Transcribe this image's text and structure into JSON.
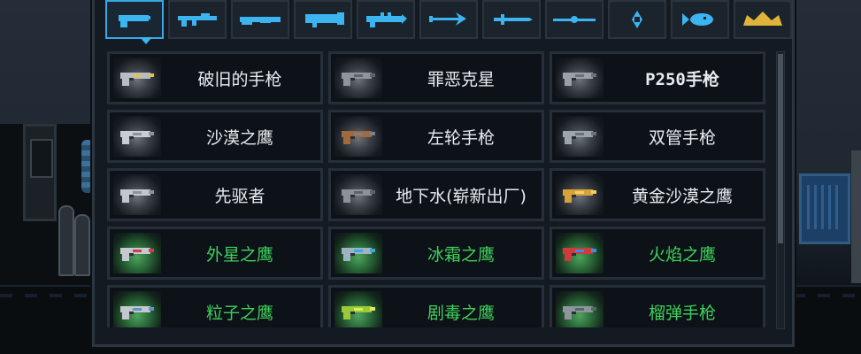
{
  "colors": {
    "tab_icon": "#3bb4f0",
    "tab_icon_gold": "#e0b33a",
    "normal_name": "#e9ecef",
    "alien_name": "#3fd15b",
    "selected_border": "#37a8e6"
  },
  "tabs": [
    {
      "icon": "pistol-icon",
      "selected": true
    },
    {
      "icon": "rifle-icon",
      "selected": false
    },
    {
      "icon": "shotgun-icon",
      "selected": false
    },
    {
      "icon": "launcher-icon",
      "selected": false
    },
    {
      "icon": "laser-gun-icon",
      "selected": false
    },
    {
      "icon": "bow-icon",
      "selected": false
    },
    {
      "icon": "sword-icon",
      "selected": false
    },
    {
      "icon": "staff-icon",
      "selected": false
    },
    {
      "icon": "shuriken-icon",
      "selected": false
    },
    {
      "icon": "fish-icon",
      "selected": false
    },
    {
      "icon": "crown-icon",
      "selected": false
    }
  ],
  "weapons": [
    {
      "name": "破旧的手枪",
      "icon": "old-pistol-icon",
      "tint": "#b9bec4",
      "accent": "#e3c14f",
      "alien": false
    },
    {
      "name": "罪恶克星",
      "icon": "revolver-icon",
      "tint": "#8e959c",
      "accent": "#5d646b",
      "alien": false
    },
    {
      "name": "P250手枪",
      "icon": "p250-pistol-icon",
      "tint": "#9aa1a8",
      "accent": "#6a7178",
      "alien": false
    },
    {
      "name": "沙漠之鹰",
      "icon": "desert-eagle-icon",
      "tint": "#c9ced3",
      "accent": "#8d949b",
      "alien": false
    },
    {
      "name": "左轮手枪",
      "icon": "wood-revolver-icon",
      "tint": "#a06a3c",
      "accent": "#7a8188",
      "alien": false
    },
    {
      "name": "双管手枪",
      "icon": "double-barrel-pistol-icon",
      "tint": "#9ea5ac",
      "accent": "#6a7178",
      "alien": false
    },
    {
      "name": "先驱者",
      "icon": "pioneer-pistol-icon",
      "tint": "#c3c8cd",
      "accent": "#8d949b",
      "alien": false
    },
    {
      "name": "地下水(崭新出厂)",
      "icon": "smg-pistol-icon",
      "tint": "#8b9299",
      "accent": "#5d646b",
      "alien": false
    },
    {
      "name": "黄金沙漠之鹰",
      "icon": "golden-eagle-icon",
      "tint": "#d8a23a",
      "accent": "#f2cf6a",
      "alien": false
    },
    {
      "name": "外星之鹰",
      "icon": "alien-eagle-icon",
      "tint": "#c8c9cf",
      "accent": "#d13a52",
      "alien": true
    },
    {
      "name": "冰霜之鹰",
      "icon": "frost-eagle-icon",
      "tint": "#9fb3c4",
      "accent": "#3aa9e0",
      "alien": true
    },
    {
      "name": "火焰之鹰",
      "icon": "flame-eagle-icon",
      "tint": "#d03a3a",
      "accent": "#3a8fe0",
      "alien": true
    },
    {
      "name": "粒子之鹰",
      "icon": "particle-eagle-icon",
      "tint": "#c3c8cd",
      "accent": "#6a8fd0",
      "alien": true
    },
    {
      "name": "剧毒之鹰",
      "icon": "poison-eagle-icon",
      "tint": "#9cc93a",
      "accent": "#d9f05a",
      "alien": true
    },
    {
      "name": "榴弹手枪",
      "icon": "grenade-pistol-icon",
      "tint": "#8e959c",
      "accent": "#5d646b",
      "alien": true
    }
  ]
}
